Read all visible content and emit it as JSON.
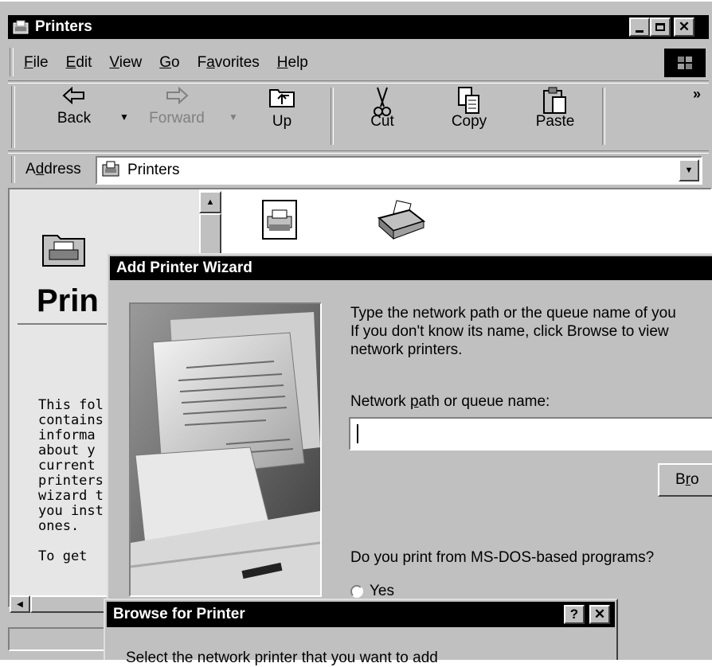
{
  "window": {
    "title": "Printers"
  },
  "menu": [
    {
      "label": "File"
    },
    {
      "label": "Edit"
    },
    {
      "label": "View"
    },
    {
      "label": "Go"
    },
    {
      "label": "Favorites"
    },
    {
      "label": "Help"
    }
  ],
  "toolbar": {
    "back": "Back",
    "forward": "Forward",
    "up": "Up",
    "cut": "Cut",
    "copy": "Copy",
    "paste": "Paste",
    "more": "»"
  },
  "address": {
    "label": "Address",
    "value": "Printers"
  },
  "sidebar": {
    "title": "Prin",
    "lines": [
      "This fol",
      "contains",
      "informa",
      "about y",
      "current",
      "printers",
      "wizard t",
      "you inst",
      "ones.",
      "",
      "To get"
    ]
  },
  "wizard": {
    "title": "Add Printer Wizard",
    "instruction_1": "Type the network path or the queue name of you",
    "instruction_2": "If you don't know its name, click Browse to view",
    "instruction_3": "network printers.",
    "path_label": "Network path or queue name:",
    "path_value": "",
    "browse_label": "Bro",
    "msdos_question": "Do you print from MS-DOS-based programs?",
    "yes_label": "Yes"
  },
  "browse_dialog": {
    "title": "Browse for Printer",
    "help": "?",
    "close": "✕",
    "prompt": "Select the network printer that you want to add"
  }
}
